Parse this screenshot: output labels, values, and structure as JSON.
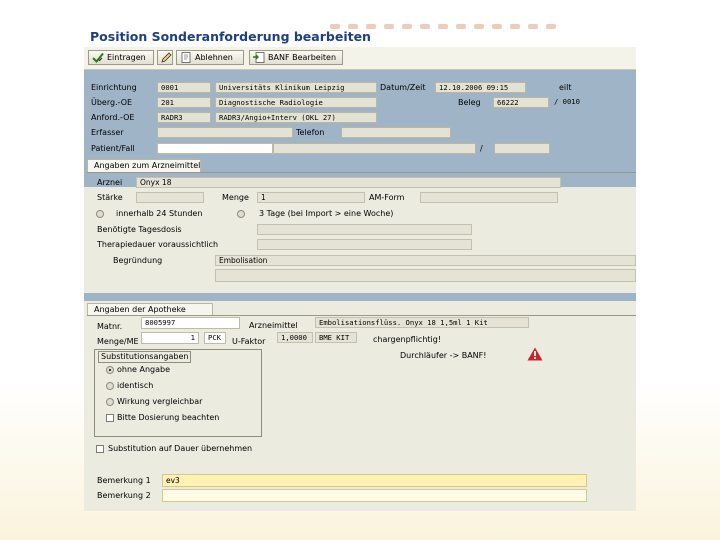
{
  "title": "Position Sonderanforderung bearbeiten",
  "toolbar": {
    "eintragen": "Eintragen",
    "ablehnen": "Ablehnen",
    "banf": "BANF Bearbeiten"
  },
  "header": {
    "einrichtung_label": "Einrichtung",
    "einrichtung_code": "0001",
    "einrichtung_name": "Universitäts Klinikum Leipzig",
    "datumzeit_label": "Datum/Zeit",
    "datumzeit_value": "12.10.2006 09:15",
    "eilt": "eilt",
    "uberg_label": "Überg.-OE",
    "uberg_code": "201",
    "uberg_name": "Diagnostische Radiologie",
    "beleg_label": "Beleg",
    "beleg_value": "66222",
    "beleg_pos": "/ 0010",
    "anford_label": "Anford.-OE",
    "anford_code": "RADR3",
    "anford_name": "RADR3/Angio+Interv (OKL 27)",
    "erfasser_label": "Erfasser",
    "telefon_label": "Telefon",
    "patient_label": "Patient/Fall",
    "slash": "/"
  },
  "arznei": {
    "tab": "Angaben zum Arzneimittel",
    "arznei_label": "Arznei",
    "arznei_value": "Onyx 18",
    "starke_label": "Stärke",
    "menge_label": "Menge",
    "menge_value": "1",
    "amform_label": "AM-Form",
    "radio1": "innerhalb 24 Stunden",
    "radio2": "3 Tage (bei Import > eine Woche)",
    "tagesdosis_label": "Benötigte Tagesdosis",
    "therapiedauer_label": "Therapiedauer voraussichtlich",
    "begrundung_label": "Begründung",
    "begrundung_value": "Embolisation"
  },
  "apotheke": {
    "tab": "Angaben der Apotheke",
    "matnr_label": "Matnr.",
    "matnr_value": "8005997",
    "arzneimittel_label": "Arzneimittel",
    "arzneimittel_value": "Embolisationsflüss. Onyx 18 1,5ml 1 Kit",
    "mengeme_label": "Menge/ME",
    "mengeme_value": "1",
    "me_unit": "PCK",
    "ufaktor_label": "U-Faktor",
    "ufaktor_value": "1,0000",
    "ufaktor_unit": "BME KIT",
    "chargen": "chargenpflichtig!",
    "durchlaufer": "Durchläufer -> BANF!",
    "subst_title": "Substitutionsangaben",
    "opt_ohne": "ohne Angabe",
    "opt_identisch": "identisch",
    "opt_wirkung": "Wirkung vergleichbar",
    "opt_dosierung": "Bitte Dosierung beachten",
    "dauer": "Substitution auf Dauer übernehmen",
    "bem1_label": "Bemerkung 1",
    "bem1_value": "ev3",
    "bem2_label": "Bemerkung 2"
  },
  "colors": {
    "header_bg": "#9fb4c6",
    "panel_bg": "#ecebe0",
    "title": "#1c3f88",
    "highlight_field": "#fff2b3",
    "warning": "#d0202a"
  }
}
